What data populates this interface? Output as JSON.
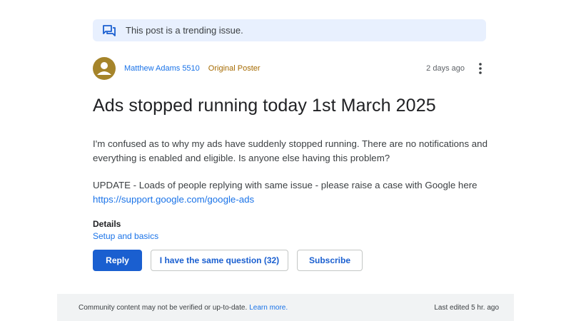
{
  "banner": {
    "text": "This post is a trending issue.",
    "icon": "forum-icon"
  },
  "author": {
    "name": "Matthew Adams 5510",
    "badge": "Original Poster",
    "timestamp": "2 days ago",
    "avatar_color": "#a5842a"
  },
  "post": {
    "title": "Ads stopped running today 1st March 2025",
    "paragraph1": "I'm confused as to why my ads have suddenly stopped running. There are no notifications and everything is enabled and eligible. Is anyone else having this problem?",
    "paragraph2_prefix": "UPDATE - Loads of people replying with same issue - please raise a case with Google here ",
    "paragraph2_link": "https://support.google.com/google-ads"
  },
  "details": {
    "label": "Details",
    "category": "Setup and basics"
  },
  "actions": {
    "reply": "Reply",
    "same_question": "I have the same question (32)",
    "subscribe": "Subscribe"
  },
  "footer": {
    "disclaimer": "Community content may not be verified or up-to-date.",
    "learn_more": "Learn more.",
    "last_edited": "Last edited 5 hr. ago"
  },
  "colors": {
    "accent": "#1a73e8",
    "primary_button": "#1a5fd0",
    "banner_bg": "#e8f0fe",
    "op_badge": "#a56a00"
  }
}
